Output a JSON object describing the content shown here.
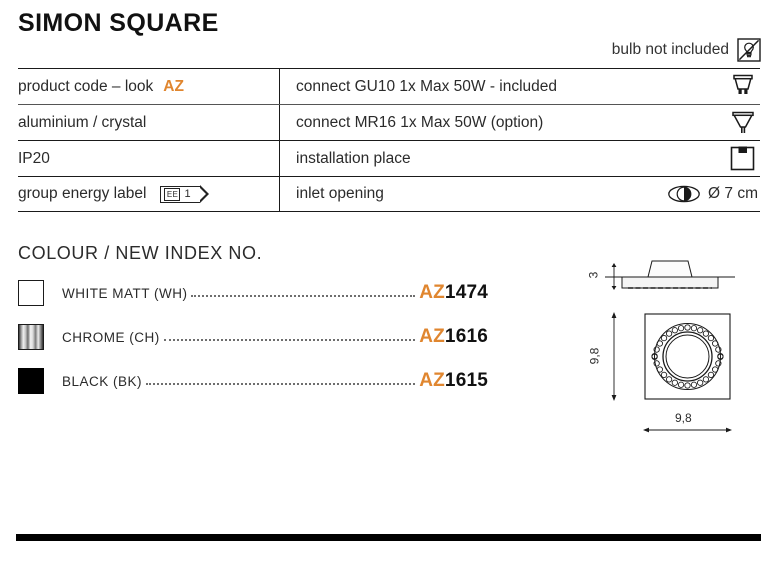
{
  "header": {
    "title": "SIMON SQUARE",
    "bulb_note": "bulb not included",
    "bulb_icon": "bulb-not-included-icon"
  },
  "spec_table": {
    "rows": [
      {
        "left": "product code – look ",
        "left_accent": "AZ",
        "right": "connect GU10 1x Max 50W - included",
        "icon": "gu10-bulb-icon"
      },
      {
        "left": "aluminium / crystal",
        "left_accent": "",
        "right": "connect MR16 1x Max 50W (option)",
        "icon": "mr16-bulb-icon"
      },
      {
        "left": "IP20",
        "left_accent": "",
        "right": "installation place",
        "icon": "ceiling-recessed-icon"
      },
      {
        "left": "group energy label",
        "left_accent": "",
        "right": "inlet opening",
        "icon": "inlet-opening-icon"
      }
    ],
    "energy_label": {
      "prefix": "EE",
      "value": "1"
    },
    "inlet_value": "Ø 7 cm"
  },
  "colour_section": {
    "heading": "COLOUR / NEW INDEX NO.",
    "items": [
      {
        "name": "WHITE MATT (WH)",
        "prefix": "AZ",
        "number": "1474",
        "swatch": "white"
      },
      {
        "name": "CHROME (CH)",
        "prefix": "AZ",
        "number": "1616",
        "swatch": "chrome"
      },
      {
        "name": "BLACK (BK)",
        "prefix": "AZ",
        "number": "1615",
        "swatch": "black"
      }
    ]
  },
  "technical_drawing": {
    "height_label": "3",
    "depth_label": "9,8",
    "width_label": "9,8"
  },
  "colors": {
    "accent_orange": "#e0862f",
    "text": "#2b2b2b",
    "line": "#1a1a1a"
  }
}
